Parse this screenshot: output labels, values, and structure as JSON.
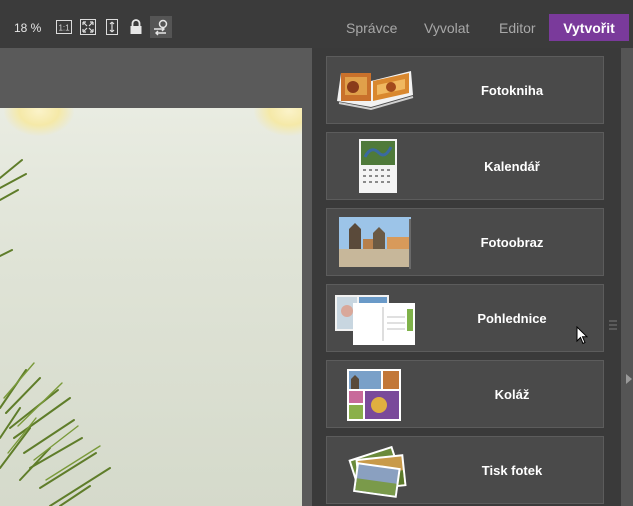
{
  "toolbar": {
    "zoom": "18 %",
    "icons": [
      "actual-size-icon",
      "fit-screen-icon",
      "fit-height-icon",
      "lock-icon",
      "person-sync-icon"
    ],
    "tabs": [
      "Správce",
      "Vyvolat",
      "Editor"
    ],
    "active_tab": "Vytvořit",
    "active_color": "#7a3a9b"
  },
  "create_panel": {
    "items": [
      {
        "label": "Fotokniha",
        "icon": "photobook-thumbnail"
      },
      {
        "label": "Kalendář",
        "icon": "calendar-thumbnail"
      },
      {
        "label": "Fotoobraz",
        "icon": "photo-canvas-thumbnail"
      },
      {
        "label": "Pohlednice",
        "icon": "postcard-thumbnail"
      },
      {
        "label": "Koláž",
        "icon": "collage-thumbnail"
      },
      {
        "label": "Tisk fotek",
        "icon": "photo-prints-thumbnail"
      }
    ]
  }
}
